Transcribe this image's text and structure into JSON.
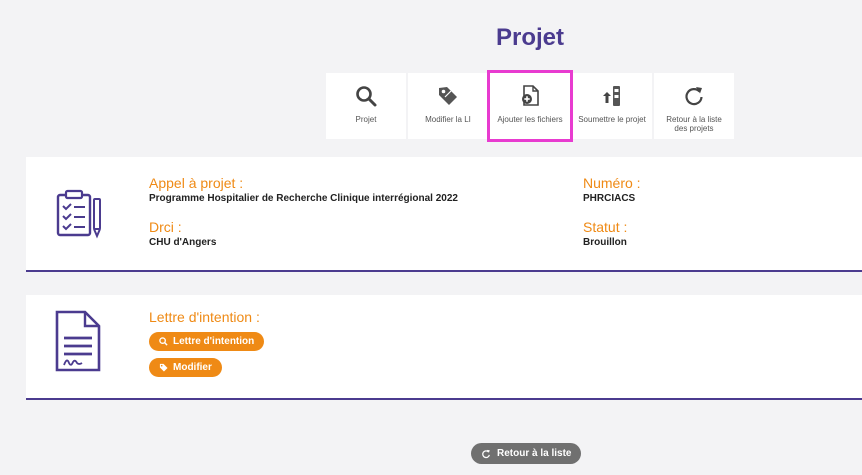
{
  "page": {
    "title": "Projet"
  },
  "toolbar": {
    "items": [
      {
        "label": "Projet"
      },
      {
        "label": "Modifier la LI"
      },
      {
        "label": "Ajouter les fichiers"
      },
      {
        "label": "Soumettre le projet"
      },
      {
        "label": "Retour à la liste des projets"
      }
    ]
  },
  "project": {
    "appel_label": "Appel à projet :",
    "appel_value": "Programme Hospitalier de Recherche Clinique interrégional 2022",
    "drci_label": "Drci :",
    "drci_value": "CHU d'Angers",
    "numero_label": "Numéro :",
    "numero_value": "PHRCIACS",
    "statut_label": "Statut :",
    "statut_value": "Brouillon"
  },
  "lettre": {
    "label": "Lettre d'intention :",
    "view_button": "Lettre d'intention",
    "edit_button": "Modifier"
  },
  "footer": {
    "back_button": "Retour à la liste"
  },
  "colors": {
    "accent": "#ef8a15",
    "brand": "#4b3b8f",
    "highlight": "#e83bd0"
  }
}
